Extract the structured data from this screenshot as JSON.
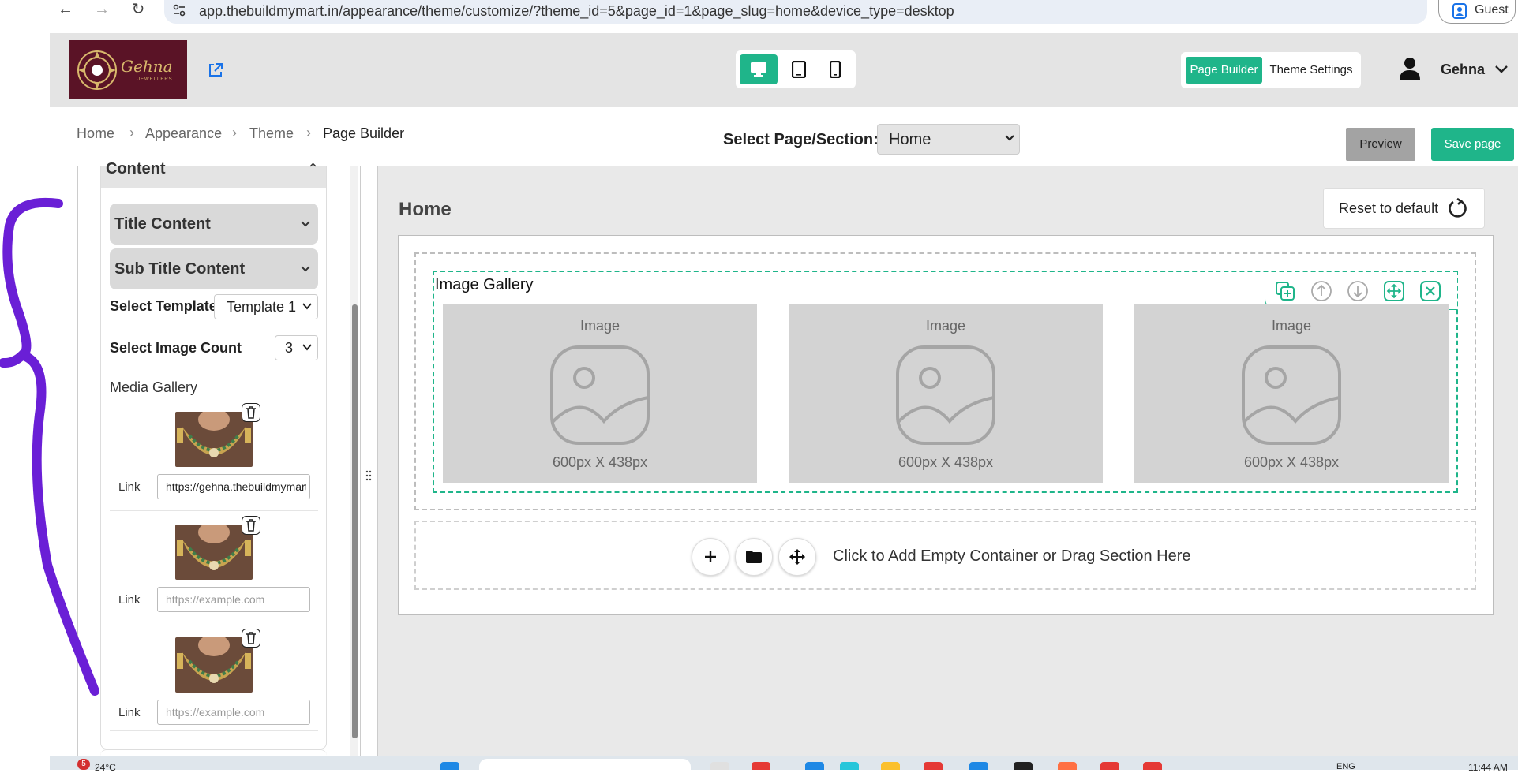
{
  "browser": {
    "url": "app.thebuildmymart.in/appearance/theme/customize/?theme_id=5&page_id=1&page_slug=home&device_type=desktop",
    "profile_label": "Guest"
  },
  "header": {
    "logo_text": "Gehna",
    "logo_subtext": "JEWELLERS",
    "mode_page_builder": "Page Builder",
    "mode_theme_settings": "Theme Settings",
    "user_name": "Gehna"
  },
  "breadcrumb": [
    "Home",
    "Appearance",
    "Theme",
    "Page Builder"
  ],
  "page_select": {
    "label": "Select Page/Section:",
    "value": "Home"
  },
  "actions": {
    "preview": "Preview",
    "save": "Save page"
  },
  "left_panel": {
    "section_title": "Content",
    "accordions": [
      "Title Content",
      "Sub Title Content"
    ],
    "select_template_label": "Select Template",
    "select_template_value": "Template 1",
    "image_count_label": "Select Image Count",
    "image_count_value": "3",
    "media_gallery_label": "Media Gallery",
    "media_items": [
      {
        "link_label": "Link",
        "value": "https://gehna.thebuildmymart",
        "placeholder": "https://example.com"
      },
      {
        "link_label": "Link",
        "value": "",
        "placeholder": "https://example.com"
      },
      {
        "link_label": "Link",
        "value": "",
        "placeholder": "https://example.com"
      }
    ]
  },
  "canvas": {
    "page_title": "Home",
    "reset_label": "Reset to default",
    "section_title": "Image Gallery",
    "images": [
      {
        "label": "Image",
        "size": "600px X 438px"
      },
      {
        "label": "Image",
        "size": "600px X 438px"
      },
      {
        "label": "Image",
        "size": "600px X 438px"
      }
    ],
    "add_container_text": "Click to Add Empty Container or Drag Section Here"
  },
  "taskbar": {
    "weather": "24°C",
    "notification_count": "5",
    "language": "ENG",
    "time": "11:44 AM"
  },
  "colors": {
    "accent": "#1fb58a",
    "brand_maroon": "#5a1326",
    "annotation": "#6a1fd6"
  }
}
